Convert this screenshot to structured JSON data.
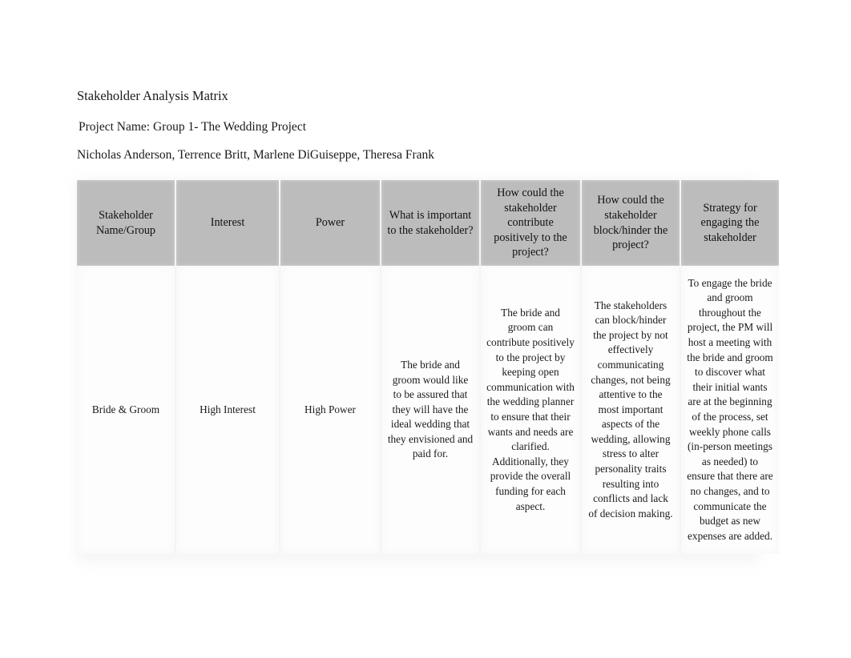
{
  "document": {
    "title": "Stakeholder Analysis Matrix",
    "project_name": " Project Name: Group 1- The Wedding Project",
    "authors": "Nicholas Anderson, Terrence Britt, Marlene DiGuiseppe, Theresa Frank"
  },
  "table": {
    "headers": [
      "Stakeholder Name/Group",
      "Interest",
      "Power",
      "What is important to the stakeholder?",
      "How could the stakeholder contribute positively to the project?",
      "How could the stakeholder block/hinder the project?",
      "Strategy for engaging the stakeholder"
    ],
    "rows": [
      {
        "stakeholder": "Bride & Groom",
        "interest": "High Interest",
        "power": "High Power",
        "important_to_stakeholder": "The bride and groom would like to be assured that they will have the ideal wedding that they envisioned and paid for.",
        "contribute_positively": "The bride and groom can contribute positively to the project by keeping open communication with the wedding planner to ensure that their wants and needs are clarified. Additionally, they provide the overall funding for each aspect.",
        "block_hinder": "The stakeholders can block/hinder the project by not effectively communicating changes, not being attentive to the most important aspects of the wedding, allowing stress to alter personality traits resulting into conflicts and lack of decision making.",
        "engagement_strategy": "To engage the bride and groom throughout the project, the PM will host a meeting with the bride and groom to discover what their initial wants are at the beginning of the process, set weekly phone calls (in-person meetings as needed) to ensure that there are no changes, and to communicate the budget as new expenses are added."
      }
    ]
  },
  "colors": {
    "header_fill": "#bcbcbc",
    "body_fill": "#fdfdfd",
    "text": "#1a1a1a",
    "page_background": "#ffffff"
  }
}
